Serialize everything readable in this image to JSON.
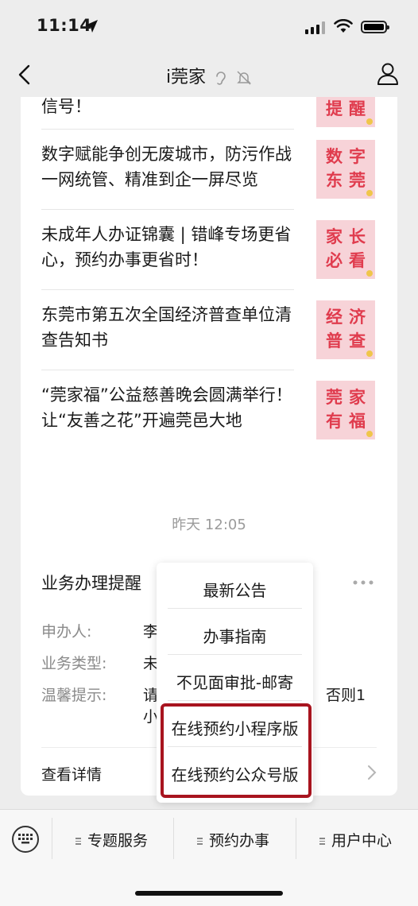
{
  "status_bar": {
    "time": "11:14"
  },
  "nav": {
    "title": "i莞家"
  },
  "articles": [
    {
      "title": "预警升级！东莞发布台风橙色预警信号！",
      "thumb": "重要\n提醒"
    },
    {
      "title": "数字赋能争创无废城市，防污作战一网统管、精准到企一屏尽览",
      "thumb": "数字\n东莞"
    },
    {
      "title": "未成年人办证锦囊 | 错峰专场更省心，预约办事更省时！",
      "thumb": "家长\n必看"
    },
    {
      "title": "东莞市第五次全国经济普查单位清查告知书",
      "thumb": "经济\n普查"
    },
    {
      "title": "“莞家福”公益慈善晚会圆满举行！让“友善之花”开遍莞邑大地",
      "thumb": "莞家\n有福"
    }
  ],
  "timestamp": "昨天 12:05",
  "business_card": {
    "title": "业务办理提醒",
    "fields": [
      {
        "label": "申办人:",
        "value": "李"
      },
      {
        "label": "业务类型:",
        "value": "未"
      },
      {
        "label": "温馨提示:",
        "value": "请",
        "value2": "小",
        "tail": "否则1"
      }
    ],
    "detail_link": "查看详情"
  },
  "popup_menu": {
    "items": [
      "最新公告",
      "办事指南",
      "不见面审批-邮寄",
      "在线预约小程序版",
      "在线预约公众号版"
    ]
  },
  "bottom_menu": {
    "items": [
      "专题服务",
      "预约办事",
      "用户中心"
    ]
  },
  "colors": {
    "background": "#ededed",
    "thumb_bg": "#f7d3d8",
    "thumb_text": "#e03c4e",
    "highlight": "#a8141f"
  }
}
